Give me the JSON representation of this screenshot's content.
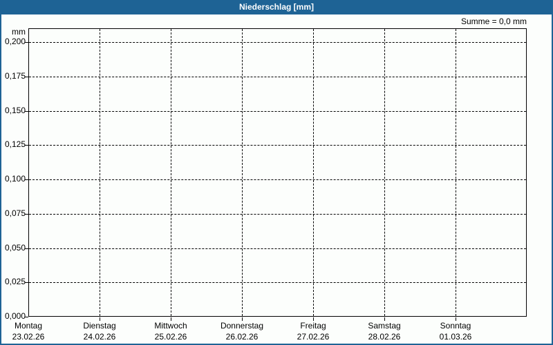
{
  "window": {
    "title": "Niederschlag [mm]"
  },
  "annotation": {
    "sum_label": "Summe = 0,0 mm"
  },
  "colors": {
    "titlebar_bg": "#1e6395",
    "titlebar_text": "#ffffff",
    "window_border": "#1e6395",
    "background": "#fcfefc",
    "grid": "#000000",
    "text": "#000000"
  },
  "chart_data": {
    "type": "line",
    "title": "Niederschlag [mm]",
    "xlabel": "",
    "ylabel": "mm",
    "ylim": [
      0.0,
      0.2
    ],
    "ytick_step": 0.025,
    "ytick_labels": [
      "0,200",
      "0,175",
      "0,150",
      "0,125",
      "0,100",
      "0,075",
      "0,050",
      "0,025",
      "0,000"
    ],
    "categories": [
      {
        "day": "Montag",
        "date": "23.02.26"
      },
      {
        "day": "Dienstag",
        "date": "24.02.26"
      },
      {
        "day": "Mittwoch",
        "date": "25.02.26"
      },
      {
        "day": "Donnerstag",
        "date": "26.02.26"
      },
      {
        "day": "Freitag",
        "date": "27.02.26"
      },
      {
        "day": "Samstag",
        "date": "28.02.26"
      },
      {
        "day": "Sonntag",
        "date": "01.03.26"
      }
    ],
    "series": [
      {
        "name": "Niederschlag",
        "values": []
      }
    ],
    "sum_annotation": "Summe = 0,0 mm",
    "grid": "dashed",
    "legend": "none"
  }
}
